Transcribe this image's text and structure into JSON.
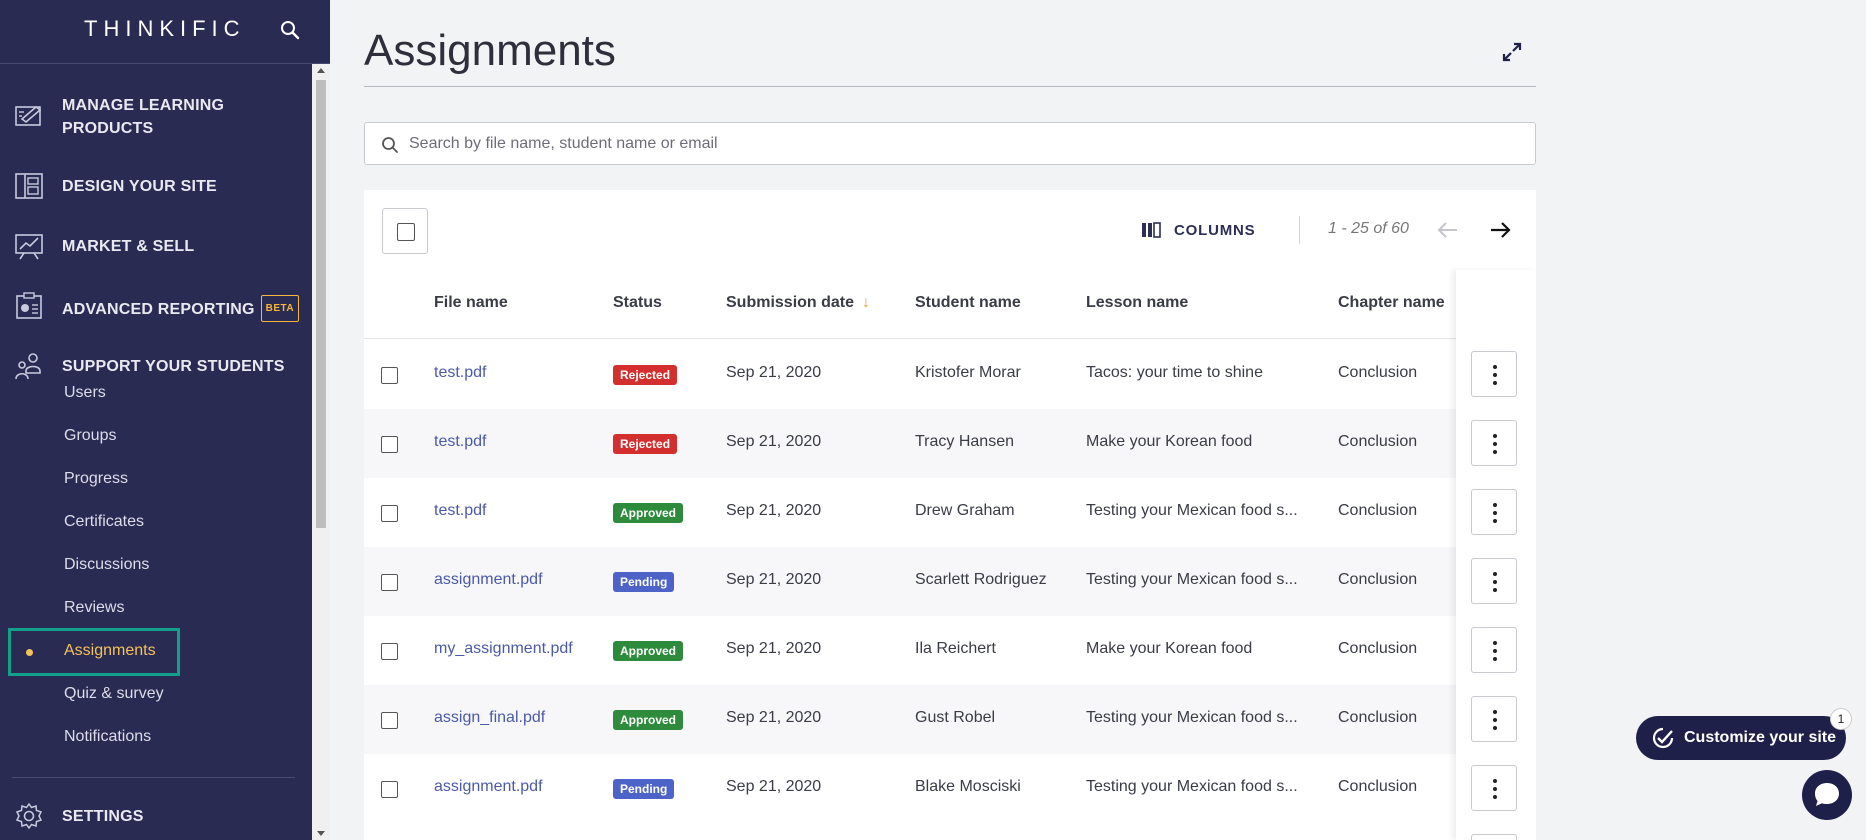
{
  "sidebar": {
    "logo": "THINKIFIC",
    "sections": [
      {
        "label": "MANAGE LEARNING PRODUCTS",
        "icon": "edit-board-icon"
      },
      {
        "label": "DESIGN YOUR SITE",
        "icon": "layout-icon"
      },
      {
        "label": "MARKET & SELL",
        "icon": "chart-board-icon"
      },
      {
        "label": "ADVANCED REPORTING",
        "icon": "report-icon",
        "badge": "BETA"
      },
      {
        "label": "SUPPORT YOUR STUDENTS",
        "icon": "students-icon"
      }
    ],
    "sub_items": [
      "Users",
      "Groups",
      "Progress",
      "Certificates",
      "Discussions",
      "Reviews",
      "Assignments",
      "Quiz & survey",
      "Notifications"
    ],
    "active_item": "Assignments",
    "settings_label": "SETTINGS"
  },
  "main": {
    "title": "Assignments",
    "search_placeholder": "Search by file name, student name or email",
    "columns_label": "COLUMNS",
    "pagination": "1 - 25 of 60"
  },
  "table": {
    "headers": [
      "File name",
      "Status",
      "Submission date",
      "Student name",
      "Lesson name",
      "Chapter name"
    ],
    "rows": [
      {
        "file": "test.pdf",
        "status": "Rejected",
        "date": "Sep 21, 2020",
        "student": "Kristofer Morar",
        "lesson": "Tacos: your time to shine",
        "chapter": "Conclusion"
      },
      {
        "file": "test.pdf",
        "status": "Rejected",
        "date": "Sep 21, 2020",
        "student": "Tracy Hansen",
        "lesson": "Make your Korean food",
        "chapter": "Conclusion"
      },
      {
        "file": "test.pdf",
        "status": "Approved",
        "date": "Sep 21, 2020",
        "student": "Drew Graham",
        "lesson": "Testing your Mexican food s...",
        "chapter": "Conclusion"
      },
      {
        "file": "assignment.pdf",
        "status": "Pending",
        "date": "Sep 21, 2020",
        "student": "Scarlett Rodriguez",
        "lesson": "Testing your Mexican food s...",
        "chapter": "Conclusion"
      },
      {
        "file": "my_assignment.pdf",
        "status": "Approved",
        "date": "Sep 21, 2020",
        "student": "Ila Reichert",
        "lesson": "Make your Korean food",
        "chapter": "Conclusion"
      },
      {
        "file": "assign_final.pdf",
        "status": "Approved",
        "date": "Sep 21, 2020",
        "student": "Gust Robel",
        "lesson": "Testing your Mexican food s...",
        "chapter": "Conclusion"
      },
      {
        "file": "assignment.pdf",
        "status": "Pending",
        "date": "Sep 21, 2020",
        "student": "Blake Mosciski",
        "lesson": "Testing your Mexican food s...",
        "chapter": "Conclusion"
      }
    ]
  },
  "floating": {
    "customize_label": "Customize your site",
    "customize_count": "1"
  },
  "colors": {
    "sidebar_bg": "#2a2b52",
    "accent_yellow": "#f5c15a",
    "active_outline": "#12a08a",
    "rejected": "#d32f2f",
    "approved": "#2e8b3c",
    "pending": "#4d63c8"
  }
}
